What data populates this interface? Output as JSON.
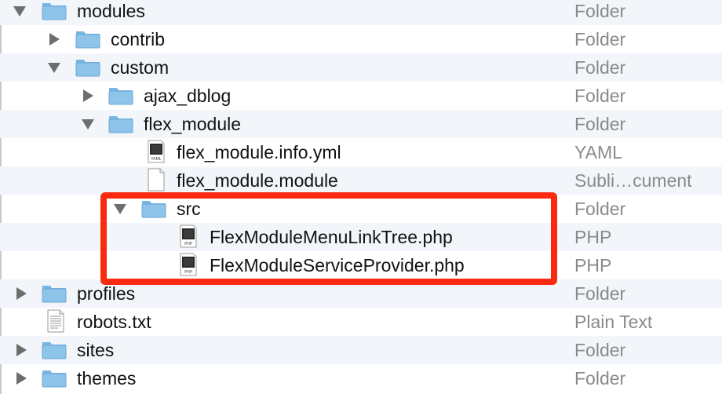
{
  "file_list": {
    "rows": [
      {
        "name": "modules",
        "kind": "Folder",
        "disclosure": "expanded",
        "icon": "folder-icon"
      },
      {
        "name": "contrib",
        "kind": "Folder",
        "disclosure": "collapsed",
        "icon": "folder-icon"
      },
      {
        "name": "custom",
        "kind": "Folder",
        "disclosure": "expanded",
        "icon": "folder-icon"
      },
      {
        "name": "ajax_dblog",
        "kind": "Folder",
        "disclosure": "collapsed",
        "icon": "folder-icon"
      },
      {
        "name": "flex_module",
        "kind": "Folder",
        "disclosure": "expanded",
        "icon": "folder-icon"
      },
      {
        "name": "flex_module.info.yml",
        "kind": "YAML",
        "disclosure": "none",
        "icon": "yaml-file-icon",
        "icon_text": "YAML"
      },
      {
        "name": "flex_module.module",
        "kind": "Subli…cument",
        "disclosure": "none",
        "icon": "document-icon"
      },
      {
        "name": "src",
        "kind": "Folder",
        "disclosure": "expanded",
        "icon": "folder-icon"
      },
      {
        "name": "FlexModuleMenuLinkTree.php",
        "kind": "PHP",
        "disclosure": "none",
        "icon": "php-file-icon",
        "icon_text": "PHP"
      },
      {
        "name": "FlexModuleServiceProvider.php",
        "kind": "PHP",
        "disclosure": "none",
        "icon": "php-file-icon",
        "icon_text": "PHP"
      },
      {
        "name": "profiles",
        "kind": "Folder",
        "disclosure": "collapsed",
        "icon": "folder-icon"
      },
      {
        "name": "robots.txt",
        "kind": "Plain Text",
        "disclosure": "none",
        "icon": "text-file-icon"
      },
      {
        "name": "sites",
        "kind": "Folder",
        "disclosure": "collapsed",
        "icon": "folder-icon"
      },
      {
        "name": "themes",
        "kind": "Folder",
        "disclosure": "collapsed",
        "icon": "folder-icon"
      }
    ]
  },
  "highlight": {
    "color": "#fa2a10"
  },
  "colors": {
    "folder_body": "#8ec4ea",
    "folder_tab": "#7ab6e2",
    "alt_row": "#f2f5f9",
    "kind_text": "#8a8a8a",
    "disclosure": "#6d6d6d"
  }
}
